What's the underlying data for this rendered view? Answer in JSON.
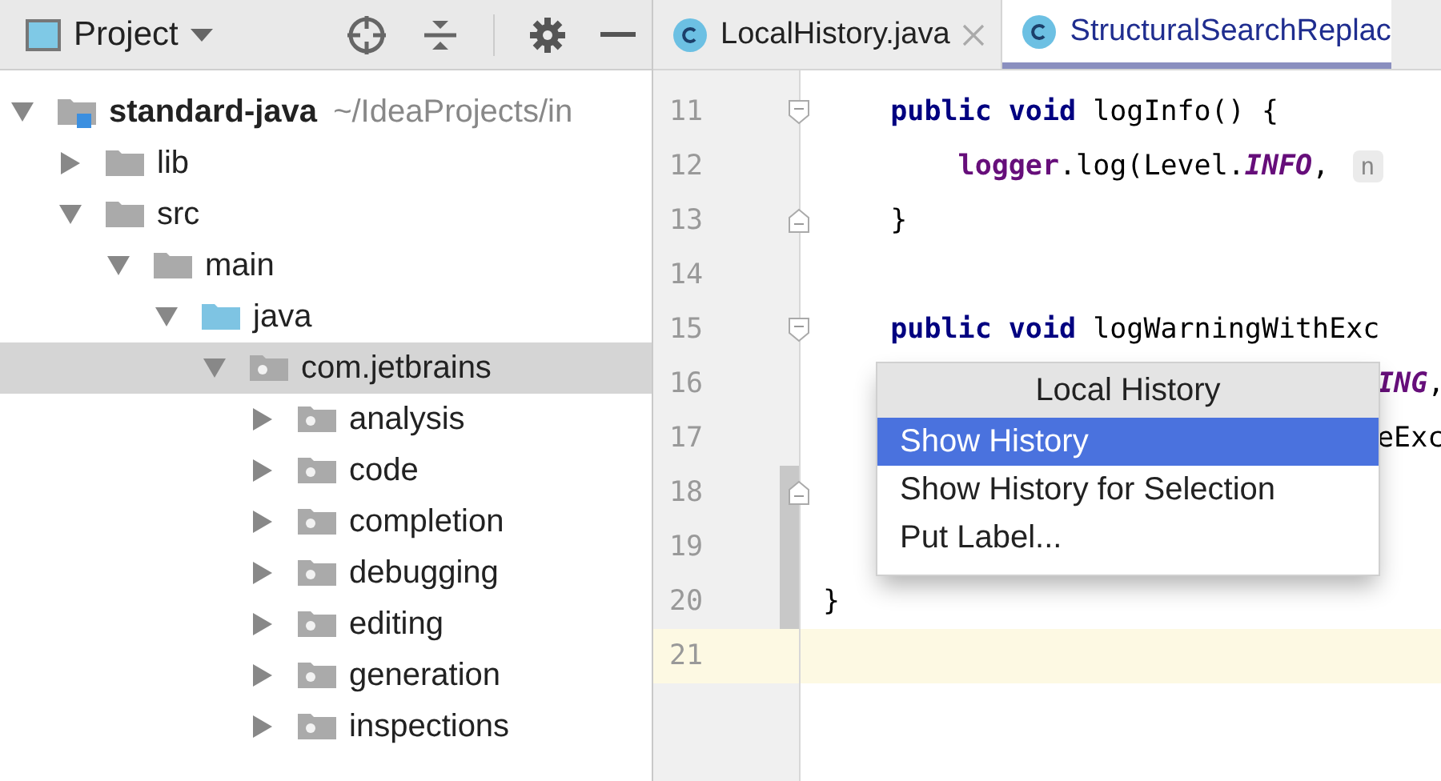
{
  "project_panel": {
    "title": "Project",
    "tree": [
      {
        "name": "standard-java",
        "path": "~/IdeaProjects/in",
        "kind": "module",
        "expanded": true,
        "selected": false,
        "children": [
          {
            "name": "lib",
            "kind": "folder",
            "expanded": false,
            "selected": false
          },
          {
            "name": "src",
            "kind": "folder",
            "expanded": true,
            "selected": false,
            "children": [
              {
                "name": "main",
                "kind": "folder",
                "expanded": true,
                "selected": false,
                "children": [
                  {
                    "name": "java",
                    "kind": "source",
                    "expanded": true,
                    "selected": false,
                    "children": [
                      {
                        "name": "com.jetbrains",
                        "kind": "package",
                        "expanded": true,
                        "selected": true,
                        "children": [
                          {
                            "name": "analysis",
                            "kind": "package",
                            "expanded": false,
                            "selected": false
                          },
                          {
                            "name": "code",
                            "kind": "package",
                            "expanded": false,
                            "selected": false
                          },
                          {
                            "name": "completion",
                            "kind": "package",
                            "expanded": false,
                            "selected": false
                          },
                          {
                            "name": "debugging",
                            "kind": "package",
                            "expanded": false,
                            "selected": false
                          },
                          {
                            "name": "editing",
                            "kind": "package",
                            "expanded": false,
                            "selected": false
                          },
                          {
                            "name": "generation",
                            "kind": "package",
                            "expanded": false,
                            "selected": false
                          },
                          {
                            "name": "inspections",
                            "kind": "package",
                            "expanded": false,
                            "selected": false
                          }
                        ]
                      }
                    ]
                  }
                ]
              }
            ]
          }
        ]
      }
    ]
  },
  "editor": {
    "tabs": [
      {
        "label": "LocalHistory.java",
        "selected": false,
        "closable": true
      },
      {
        "label": "StructuralSearchReplac",
        "selected": true,
        "closable": false
      }
    ],
    "lines": [
      {
        "number": "11",
        "kind": "normal",
        "markers": [
          {
            "kind": "fold_start"
          }
        ],
        "tokens": [
          {
            "kind": "keyword",
            "text": "    public void"
          },
          {
            "kind": "plain",
            "text": " logInfo() {"
          }
        ]
      },
      {
        "number": "12",
        "kind": "normal",
        "tokens": [
          {
            "kind": "field",
            "text": "        logger"
          },
          {
            "kind": "plain",
            "text": ".log(Level."
          },
          {
            "kind": "static",
            "text": "INFO"
          },
          {
            "kind": "plain",
            "text": ", "
          },
          {
            "kind": "hint",
            "text": "n"
          }
        ]
      },
      {
        "number": "13",
        "kind": "normal",
        "markers": [
          {
            "kind": "fold_end"
          }
        ],
        "tokens": [
          {
            "kind": "plain",
            "text": "    }"
          }
        ]
      },
      {
        "number": "14",
        "kind": "normal"
      },
      {
        "number": "15",
        "kind": "normal",
        "markers": [
          {
            "kind": "fold_start"
          }
        ],
        "tokens": [
          {
            "kind": "keyword",
            "text": "    public void"
          },
          {
            "kind": "plain",
            "text": " logWarningWithExc"
          }
        ]
      },
      {
        "number": "16",
        "kind": "partial",
        "tokens": [
          {
            "kind": "static",
            "text": "ING"
          },
          {
            "kind": "plain",
            "text": ","
          }
        ]
      },
      {
        "number": "17",
        "kind": "partial",
        "tokens": [
          {
            "kind": "plain",
            "text": "eExc"
          }
        ]
      },
      {
        "number": "18",
        "kind": "normal",
        "markers": [
          {
            "kind": "change"
          },
          {
            "kind": "fold_end"
          }
        ]
      },
      {
        "number": "19",
        "kind": "normal",
        "markers": [
          {
            "kind": "change"
          }
        ]
      },
      {
        "number": "20",
        "kind": "normal",
        "markers": [
          {
            "kind": "change"
          }
        ],
        "tokens": [
          {
            "kind": "plain",
            "text": "}"
          }
        ]
      },
      {
        "number": "21",
        "kind": "current"
      }
    ],
    "popup": {
      "title": "Local History",
      "items": [
        {
          "label": "Show History",
          "selected": true
        },
        {
          "label": "Show History for Selection",
          "selected": false
        },
        {
          "label": "Put Label...",
          "selected": false
        }
      ]
    }
  }
}
